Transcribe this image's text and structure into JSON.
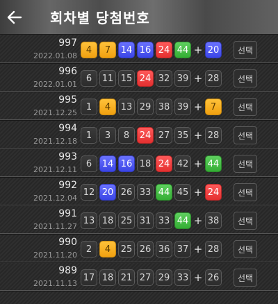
{
  "header": {
    "title": "회차별 당첨번호"
  },
  "select_label": "선택",
  "rounds": [
    {
      "round": "997",
      "date": "2022.01.08",
      "numbers": [
        {
          "n": "4",
          "c": "yellow"
        },
        {
          "n": "7",
          "c": "yellow"
        },
        {
          "n": "14",
          "c": "blue"
        },
        {
          "n": "16",
          "c": "blue"
        },
        {
          "n": "24",
          "c": "red"
        },
        {
          "n": "44",
          "c": "green"
        }
      ],
      "bonus": {
        "n": "20",
        "c": "blue"
      }
    },
    {
      "round": "996",
      "date": "2022.01.01",
      "numbers": [
        {
          "n": "6",
          "c": "plain"
        },
        {
          "n": "11",
          "c": "plain"
        },
        {
          "n": "15",
          "c": "plain"
        },
        {
          "n": "24",
          "c": "red"
        },
        {
          "n": "32",
          "c": "plain"
        },
        {
          "n": "39",
          "c": "plain"
        }
      ],
      "bonus": {
        "n": "28",
        "c": "plain"
      }
    },
    {
      "round": "995",
      "date": "2021.12.25",
      "numbers": [
        {
          "n": "1",
          "c": "plain"
        },
        {
          "n": "4",
          "c": "yellow"
        },
        {
          "n": "13",
          "c": "plain"
        },
        {
          "n": "29",
          "c": "plain"
        },
        {
          "n": "38",
          "c": "plain"
        },
        {
          "n": "39",
          "c": "plain"
        }
      ],
      "bonus": {
        "n": "7",
        "c": "yellow"
      }
    },
    {
      "round": "994",
      "date": "2021.12.18",
      "numbers": [
        {
          "n": "1",
          "c": "plain"
        },
        {
          "n": "3",
          "c": "plain"
        },
        {
          "n": "8",
          "c": "plain"
        },
        {
          "n": "24",
          "c": "red"
        },
        {
          "n": "27",
          "c": "plain"
        },
        {
          "n": "35",
          "c": "plain"
        }
      ],
      "bonus": {
        "n": "28",
        "c": "plain"
      }
    },
    {
      "round": "993",
      "date": "2021.12.11",
      "numbers": [
        {
          "n": "6",
          "c": "plain"
        },
        {
          "n": "14",
          "c": "blue"
        },
        {
          "n": "16",
          "c": "blue"
        },
        {
          "n": "18",
          "c": "plain"
        },
        {
          "n": "24",
          "c": "red"
        },
        {
          "n": "42",
          "c": "plain"
        }
      ],
      "bonus": {
        "n": "44",
        "c": "green"
      }
    },
    {
      "round": "992",
      "date": "2021.12.04",
      "numbers": [
        {
          "n": "12",
          "c": "plain"
        },
        {
          "n": "20",
          "c": "blue"
        },
        {
          "n": "26",
          "c": "plain"
        },
        {
          "n": "33",
          "c": "plain"
        },
        {
          "n": "44",
          "c": "green"
        },
        {
          "n": "45",
          "c": "plain"
        }
      ],
      "bonus": {
        "n": "24",
        "c": "red"
      }
    },
    {
      "round": "991",
      "date": "2021.11.27",
      "numbers": [
        {
          "n": "13",
          "c": "plain"
        },
        {
          "n": "18",
          "c": "plain"
        },
        {
          "n": "25",
          "c": "plain"
        },
        {
          "n": "31",
          "c": "plain"
        },
        {
          "n": "33",
          "c": "plain"
        },
        {
          "n": "44",
          "c": "green"
        }
      ],
      "bonus": {
        "n": "38",
        "c": "plain"
      }
    },
    {
      "round": "990",
      "date": "2021.11.20",
      "numbers": [
        {
          "n": "2",
          "c": "plain"
        },
        {
          "n": "4",
          "c": "yellow"
        },
        {
          "n": "25",
          "c": "plain"
        },
        {
          "n": "26",
          "c": "plain"
        },
        {
          "n": "36",
          "c": "plain"
        },
        {
          "n": "37",
          "c": "plain"
        }
      ],
      "bonus": {
        "n": "28",
        "c": "plain"
      }
    },
    {
      "round": "989",
      "date": "2021.11.13",
      "numbers": [
        {
          "n": "17",
          "c": "plain"
        },
        {
          "n": "18",
          "c": "plain"
        },
        {
          "n": "21",
          "c": "plain"
        },
        {
          "n": "27",
          "c": "plain"
        },
        {
          "n": "29",
          "c": "plain"
        },
        {
          "n": "33",
          "c": "plain"
        }
      ],
      "bonus": {
        "n": "26",
        "c": "plain"
      }
    }
  ]
}
